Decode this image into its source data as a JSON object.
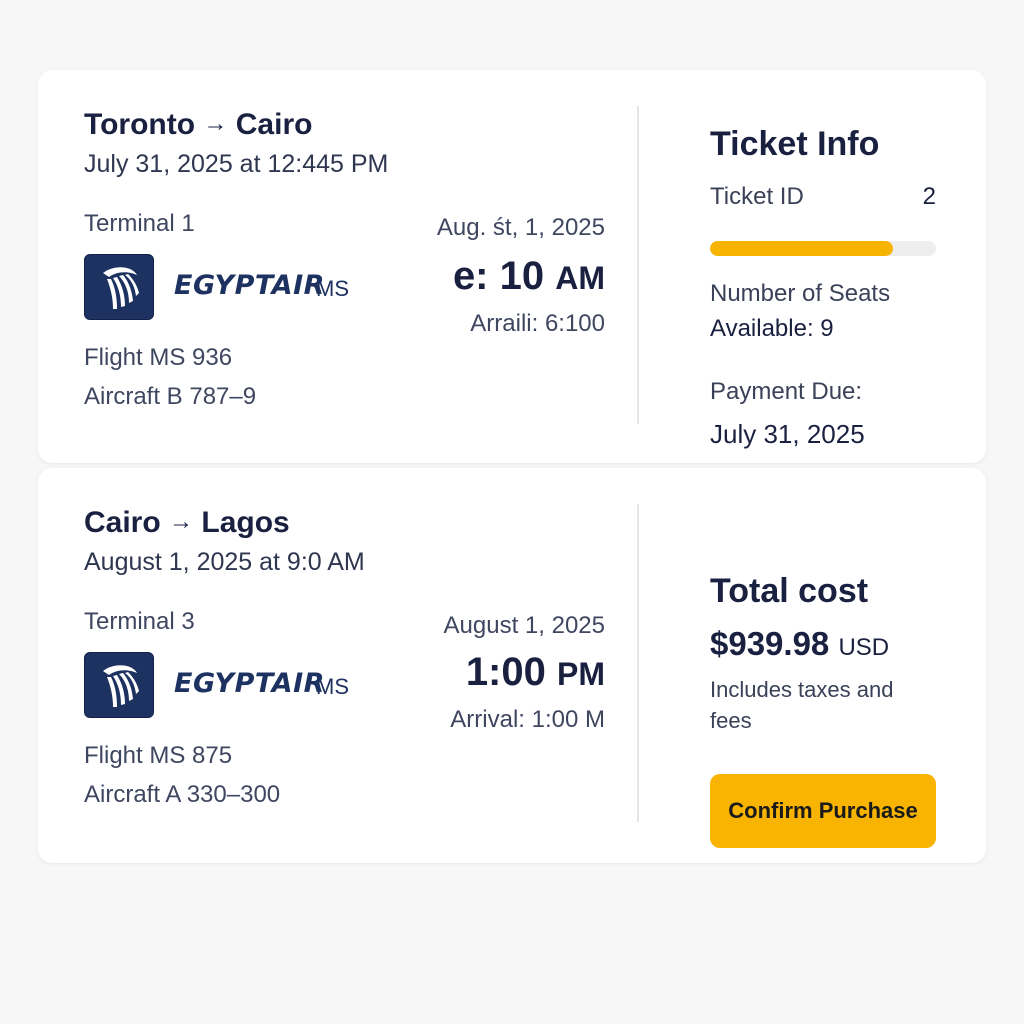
{
  "segments": [
    {
      "route_from": "Toronto",
      "route_arrow": "→",
      "route_to": "Cairo",
      "date_line": "July 31, 2025 at 12:445 PM",
      "terminal": "Terminal 1",
      "airline": "EGYPTAIR",
      "airline_code": "MS",
      "dep_date": "Aug. śt, 1, 2025",
      "dep_time": "e: 10",
      "dep_ampm": "AM",
      "arrival": "Arraili: 6:100",
      "flight": "Flight MS 936",
      "aircraft": "Aircraft B 787–9"
    },
    {
      "route_from": "Cairo",
      "route_arrow": "→",
      "route_to": "Lagos",
      "date_line": "August 1, 2025 at 9:0 AM",
      "terminal": "Terminal 3",
      "airline": "EGYPTAIR",
      "airline_code": "MS",
      "dep_date": "August  1, 2025",
      "dep_time": "1:00",
      "dep_ampm": "PM",
      "arrival": "Arrival: 1:00 M",
      "flight": "Flight MS 875",
      "aircraft": "Aircraft A 330–300"
    }
  ],
  "ticket_info": {
    "title": "Ticket Info",
    "id_label": "Ticket ID",
    "id_value": "2",
    "progress_fraction": 0.81,
    "seats_line1": "Number of Seats",
    "seats_line2": "Available: 9",
    "payment_label": "Payment Due:",
    "payment_date": "July 31, 2025"
  },
  "total": {
    "title": "Total cost",
    "amount": "$939.98",
    "currency": "USD",
    "note": "Includes taxes and fees",
    "confirm_label": "Confirm Purchase"
  },
  "colors": {
    "accent": "#f8b400",
    "navy": "#1d3260",
    "text": "#1a2140"
  },
  "icons": {
    "airline_logo": "egyptair-horus-logo"
  }
}
